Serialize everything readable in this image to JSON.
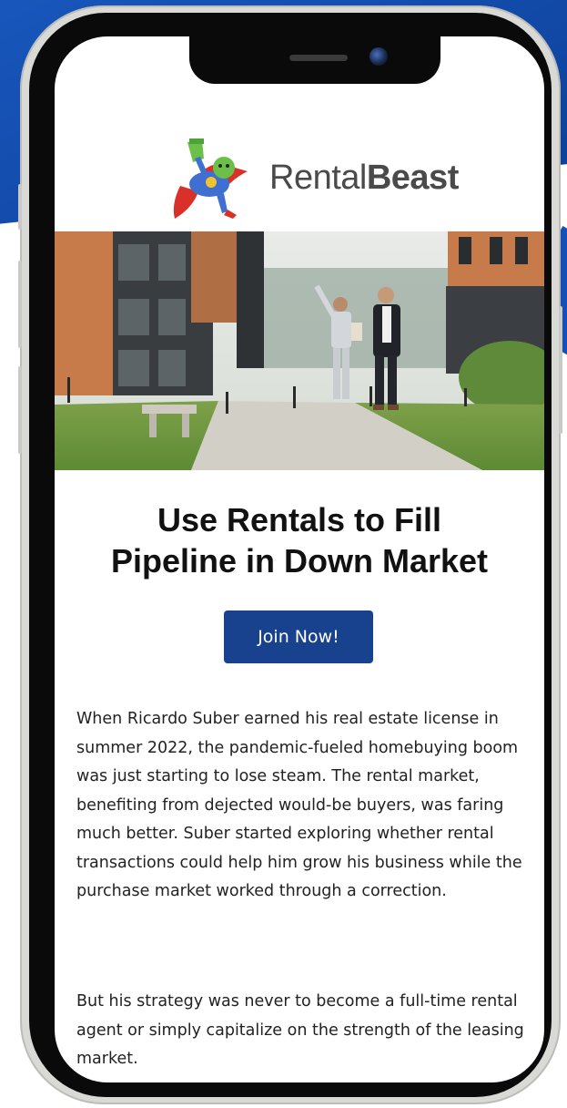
{
  "brand": {
    "name_light": "Rental",
    "name_bold": "Beast"
  },
  "article": {
    "headline_line1": "Use Rentals to Fill",
    "headline_line2": "Pipeline in Down Market",
    "cta_label": "Join Now!",
    "paragraph1": "When Ricardo Suber earned his real estate license in summer 2022, the pandemic-fueled homebuying boom was just starting to lose steam. The rental market, benefiting from dejected would-be buyers, was faring much better. Suber started exploring whether rental transactions could help him grow his business while the purchase market worked through a correction.",
    "paragraph2": "But his strategy was never to become a full-time rental agent or simply capitalize on the strength of the leasing market."
  },
  "colors": {
    "accent_blue": "#19428e",
    "background_blue": "#1550b8"
  },
  "icons": {
    "mascot": "superhero-beast-mascot-icon",
    "camera": "front-camera-icon"
  }
}
